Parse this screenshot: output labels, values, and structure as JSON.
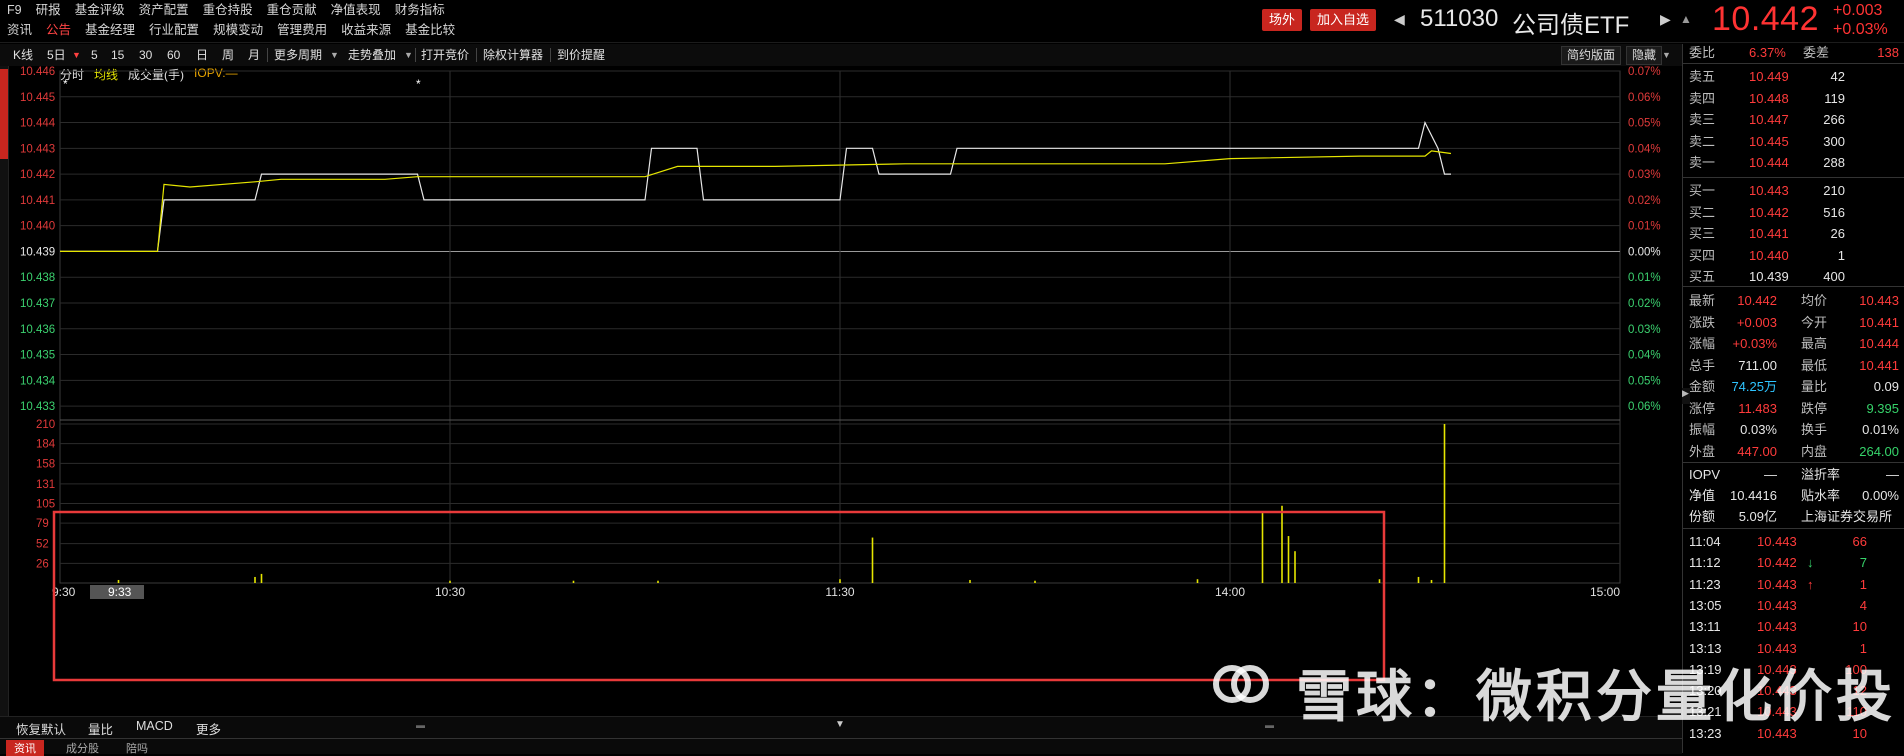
{
  "menu": {
    "row1": [
      "F9",
      "研报",
      "基金评级",
      "资产配置",
      "重仓持股",
      "重仓贡献",
      "净值表现",
      "财务指标"
    ],
    "row2": [
      "资讯",
      "公告",
      "基金经理",
      "行业配置",
      "规模变动",
      "管理费用",
      "收益来源",
      "基金比较"
    ],
    "row2_active_index": 1
  },
  "header": {
    "btn_outside": "场外",
    "btn_add": "加入自选",
    "code": "511030",
    "name": "公司债ETF",
    "price": "10.442",
    "change": "+0.003",
    "change_pct": "+0.03%"
  },
  "toolbar": {
    "kline": "K线",
    "period": "5日",
    "p5": "5",
    "p15": "15",
    "p30": "30",
    "p60": "60",
    "day": "日",
    "week": "周",
    "month": "月",
    "more_period": "更多周期",
    "trend_overlay": "走势叠加",
    "open_auction": "打开竞价",
    "rights_calc": "除权计算器",
    "price_alert": "到价提醒",
    "simple": "简约版面",
    "hide": "隐藏"
  },
  "legend": {
    "timeshare": "分时",
    "avg": "均线",
    "volume": "成交量(手)",
    "iopv": "IOPV:—"
  },
  "chart_data": {
    "type": "line",
    "title": "",
    "prev_close": 10.439,
    "y_ticks": [
      "10.446",
      "10.445",
      "10.444",
      "10.443",
      "10.442",
      "10.441",
      "10.440",
      "10.439",
      "10.438",
      "10.437",
      "10.436",
      "10.435",
      "10.434",
      "10.433"
    ],
    "y_range": [
      10.4325,
      10.446
    ],
    "pct_ticks": [
      "0.07%",
      "0.06%",
      "0.05%",
      "0.04%",
      "0.03%",
      "0.02%",
      "0.01%",
      "0.00%",
      "0.01%",
      "0.02%",
      "0.03%",
      "0.04%",
      "0.05%",
      "0.06%"
    ],
    "x_ticks": [
      "9:30",
      "10:30",
      "11:30",
      "14:00",
      "15:00"
    ],
    "cursor_label": "9:33",
    "series": [
      {
        "name": "分时",
        "x_minutes": [
          0,
          15,
          16,
          30,
          31,
          55,
          56,
          58,
          59,
          90,
          91,
          98,
          99,
          108,
          109,
          110,
          111,
          120,
          121,
          125,
          126,
          137,
          138,
          160,
          161,
          167,
          168,
          180,
          181,
          183,
          184,
          199,
          200,
          209,
          210,
          212,
          213,
          214
        ],
        "values": [
          10.439,
          10.439,
          10.441,
          10.441,
          10.442,
          10.442,
          10.441,
          10.441,
          10.441,
          10.441,
          10.443,
          10.443,
          10.441,
          10.441,
          10.441,
          10.441,
          10.441,
          10.441,
          10.443,
          10.443,
          10.442,
          10.442,
          10.443,
          10.443,
          10.443,
          10.443,
          10.443,
          10.443,
          10.443,
          10.443,
          10.443,
          10.443,
          10.443,
          10.443,
          10.444,
          10.443,
          10.442,
          10.442
        ]
      },
      {
        "name": "均线",
        "x_minutes": [
          0,
          15,
          16,
          20,
          30,
          34,
          50,
          55,
          58,
          90,
          95,
          110,
          130,
          150,
          170,
          180,
          200,
          210,
          211,
          214
        ],
        "values": [
          10.439,
          10.439,
          10.4416,
          10.4415,
          10.4417,
          10.4418,
          10.4418,
          10.4419,
          10.4419,
          10.4419,
          10.4423,
          10.4423,
          10.4424,
          10.4424,
          10.4424,
          10.4426,
          10.4427,
          10.4427,
          10.4429,
          10.4428
        ]
      }
    ],
    "volume": {
      "y_ticks": [
        "210",
        "184",
        "158",
        "131",
        "105",
        "79",
        "52",
        "26"
      ],
      "y_max": 210,
      "bars": [
        {
          "x": 9,
          "v": 4
        },
        {
          "x": 30,
          "v": 8
        },
        {
          "x": 31,
          "v": 12
        },
        {
          "x": 60,
          "v": 3
        },
        {
          "x": 79,
          "v": 3
        },
        {
          "x": 92,
          "v": 3
        },
        {
          "x": 120,
          "v": 5
        },
        {
          "x": 125,
          "v": 60
        },
        {
          "x": 140,
          "v": 4
        },
        {
          "x": 150,
          "v": 3
        },
        {
          "x": 175,
          "v": 5
        },
        {
          "x": 185,
          "v": 95
        },
        {
          "x": 188,
          "v": 102
        },
        {
          "x": 189,
          "v": 62
        },
        {
          "x": 190,
          "v": 42
        },
        {
          "x": 203,
          "v": 5
        },
        {
          "x": 209,
          "v": 8
        },
        {
          "x": 211,
          "v": 4
        },
        {
          "x": 213,
          "v": 210
        }
      ]
    },
    "grid": true
  },
  "vol_tabs": {
    "restore": "恢复默认",
    "ratio": "量比",
    "macd": "MACD",
    "more": "更多"
  },
  "bottom_strip": [
    "资讯",
    "成分股",
    "陪吗"
  ],
  "orderbook": {
    "weibi_label": "委比",
    "weibi": "6.37%",
    "weicha_label": "委差",
    "weicha": "138",
    "asks": [
      {
        "label": "卖五",
        "price": "10.449",
        "vol": "42"
      },
      {
        "label": "卖四",
        "price": "10.448",
        "vol": "119"
      },
      {
        "label": "卖三",
        "price": "10.447",
        "vol": "266"
      },
      {
        "label": "卖二",
        "price": "10.445",
        "vol": "300"
      },
      {
        "label": "卖一",
        "price": "10.444",
        "vol": "288"
      }
    ],
    "bids": [
      {
        "label": "买一",
        "price": "10.443",
        "vol": "210"
      },
      {
        "label": "买二",
        "price": "10.442",
        "vol": "516"
      },
      {
        "label": "买三",
        "price": "10.441",
        "vol": "26"
      },
      {
        "label": "买四",
        "price": "10.440",
        "vol": "1"
      },
      {
        "label": "买五",
        "price": "10.439",
        "vol": "400"
      }
    ]
  },
  "stats": [
    {
      "l1": "最新",
      "v1": "10.442",
      "c1": "red",
      "l2": "均价",
      "v2": "10.443",
      "c2": "red"
    },
    {
      "l1": "涨跌",
      "v1": "+0.003",
      "c1": "red",
      "l2": "今开",
      "v2": "10.441",
      "c2": "red"
    },
    {
      "l1": "涨幅",
      "v1": "+0.03%",
      "c1": "red",
      "l2": "最高",
      "v2": "10.444",
      "c2": "red"
    },
    {
      "l1": "总手",
      "v1": "711.00",
      "c1": "white",
      "l2": "最低",
      "v2": "10.441",
      "c2": "red"
    },
    {
      "l1": "金额",
      "v1": "74.25万",
      "c1": "cyan",
      "l2": "量比",
      "v2": "0.09",
      "c2": "white"
    },
    {
      "l1": "涨停",
      "v1": "11.483",
      "c1": "red",
      "l2": "跌停",
      "v2": "9.395",
      "c2": "green"
    },
    {
      "l1": "振幅",
      "v1": "0.03%",
      "c1": "white",
      "l2": "换手",
      "v2": "0.01%",
      "c2": "white"
    },
    {
      "l1": "外盘",
      "v1": "447.00",
      "c1": "red",
      "l2": "内盘",
      "v2": "264.00",
      "c2": "green"
    }
  ],
  "fund_info": [
    {
      "l1": "IOPV",
      "v1": "—",
      "l2": "溢折率",
      "v2": "—"
    },
    {
      "l1": "净值",
      "v1": "10.4416",
      "l2": "贴水率",
      "v2": "0.00%"
    },
    {
      "l1": "份额",
      "v1": "5.09亿",
      "l2": "上海证券交易所",
      "v2": ""
    }
  ],
  "ticks": [
    {
      "t": "11:04",
      "p": "10.443",
      "arrow": "",
      "v": "66",
      "vc": "red"
    },
    {
      "t": "11:12",
      "p": "10.442",
      "arrow": "↓",
      "v": "7",
      "vc": "green"
    },
    {
      "t": "11:23",
      "p": "10.443",
      "arrow": "↑",
      "v": "1",
      "vc": "red"
    },
    {
      "t": "13:05",
      "p": "10.443",
      "arrow": "",
      "v": "4",
      "vc": "red"
    },
    {
      "t": "13:11",
      "p": "10.443",
      "arrow": "",
      "v": "10",
      "vc": "red"
    },
    {
      "t": "13:13",
      "p": "10.443",
      "arrow": "",
      "v": "1",
      "vc": "red"
    },
    {
      "t": "13:19",
      "p": "10.443",
      "arrow": "",
      "v": "100",
      "vc": "red"
    },
    {
      "t": "13:20",
      "p": "10.443",
      "arrow": "",
      "v": "12",
      "vc": "red"
    },
    {
      "t": "13:21",
      "p": "10.443",
      "arrow": "",
      "v": "110",
      "vc": "red"
    },
    {
      "t": "13:23",
      "p": "10.443",
      "arrow": "",
      "v": "10",
      "vc": "red"
    }
  ],
  "watermark": "雪球：微积分量化价投",
  "colors": {
    "up": "#ff3b3b",
    "down": "#36d36a",
    "price_line": "#e8e8e8",
    "avg_line": "#e6e600",
    "highlight_box": "#e83a3a"
  }
}
